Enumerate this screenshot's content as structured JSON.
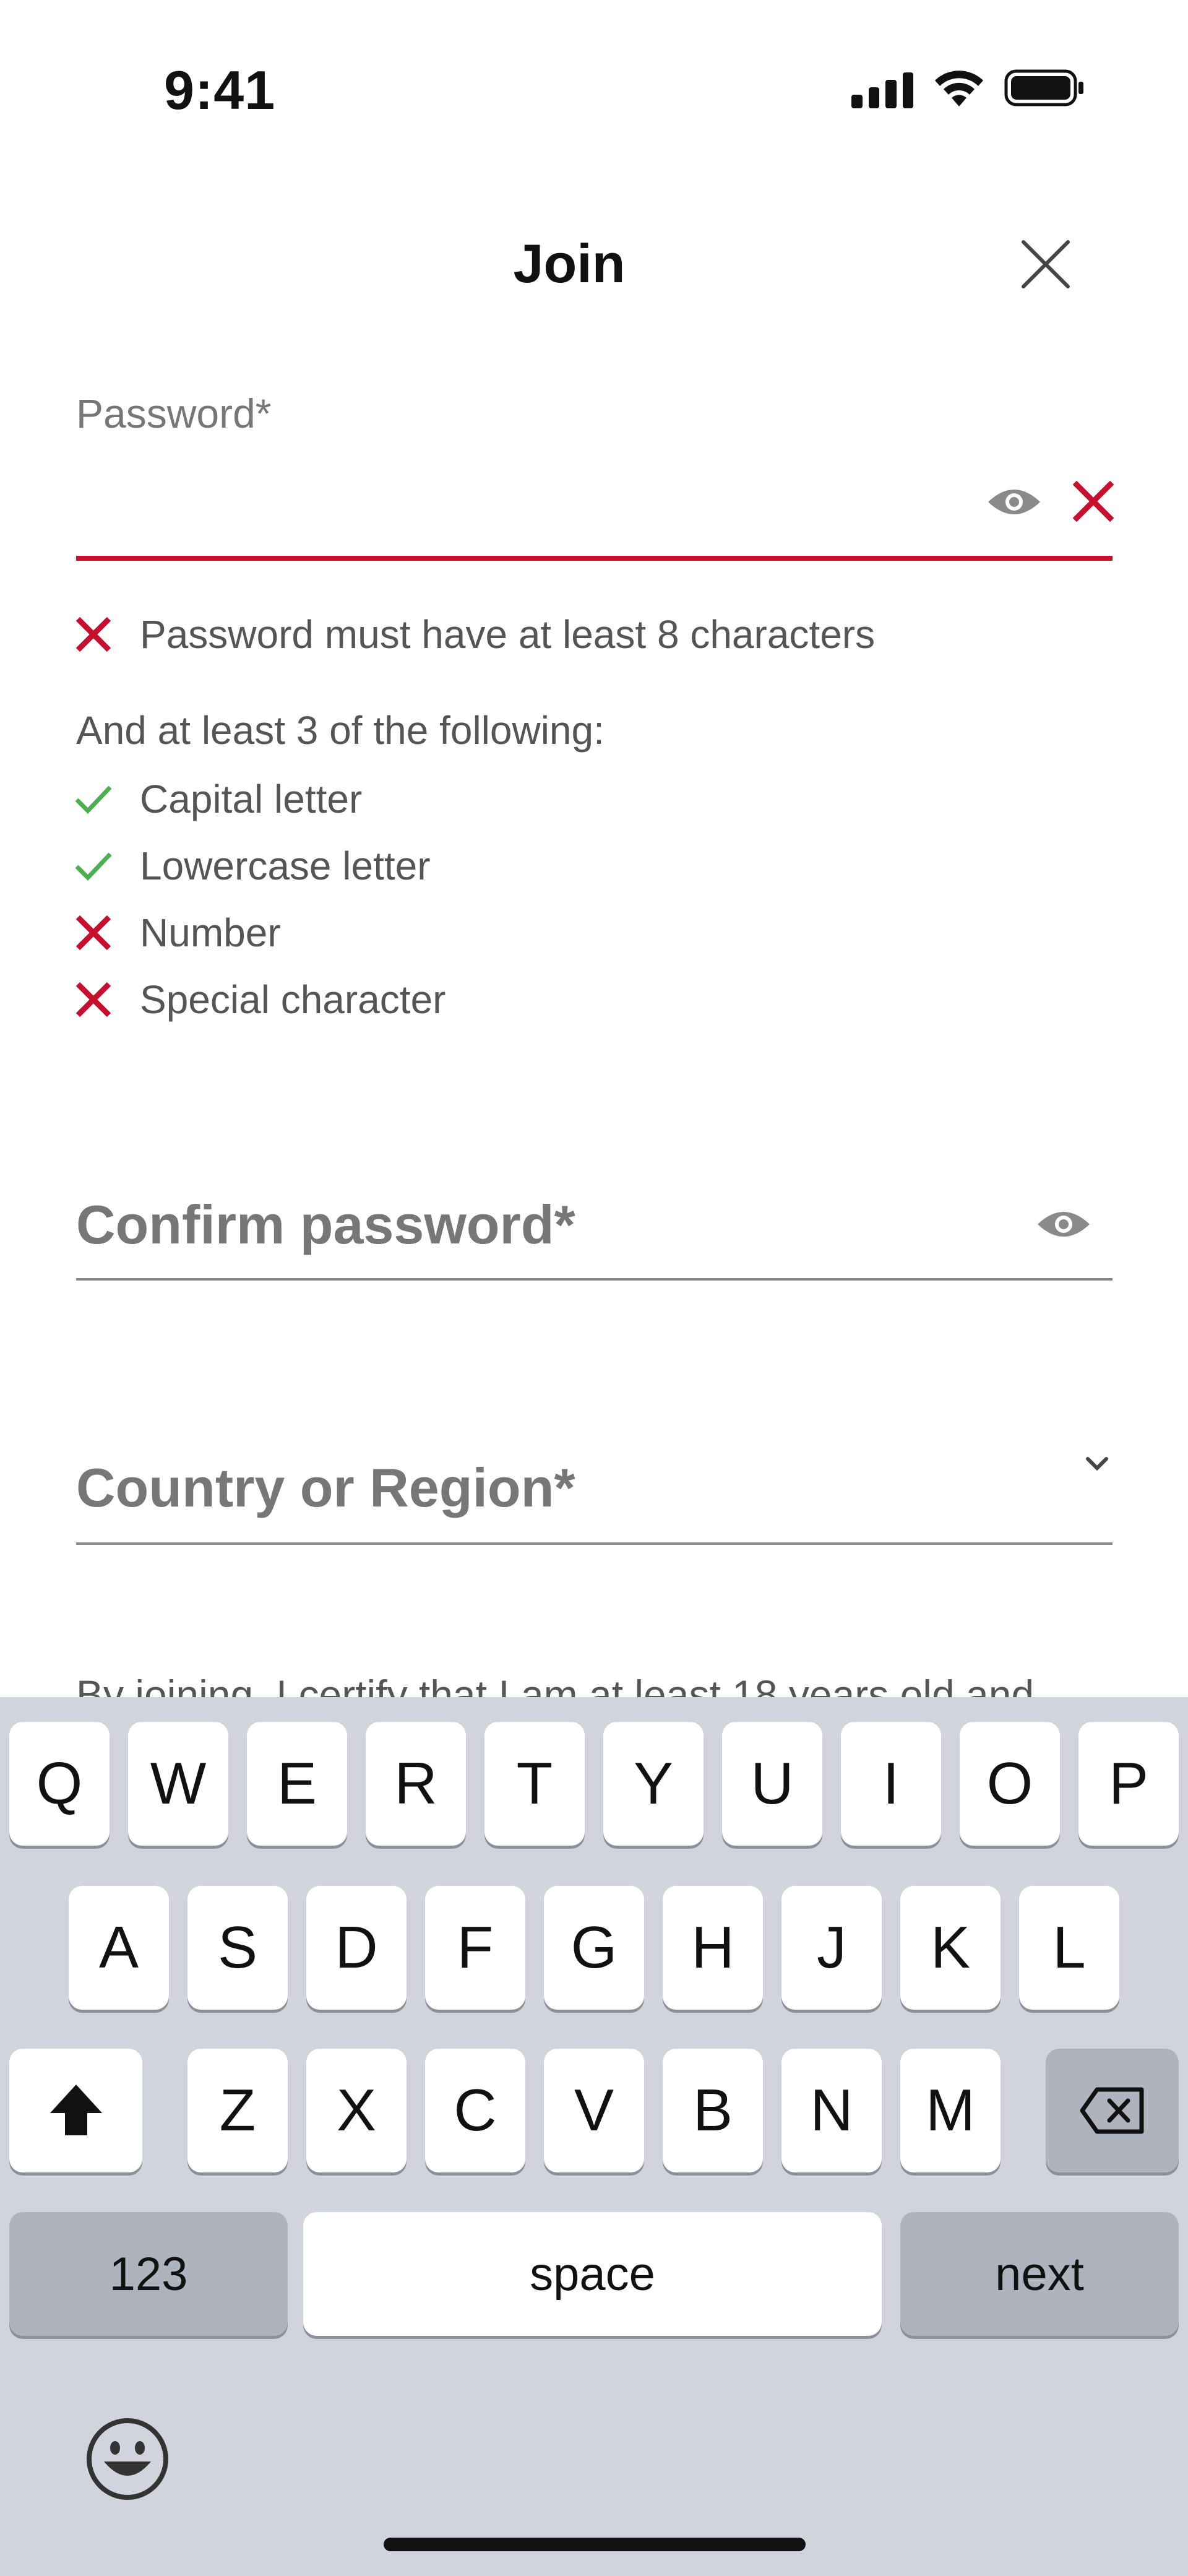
{
  "status_bar": {
    "time": "9:41"
  },
  "header": {
    "title": "Join"
  },
  "password": {
    "label": "Password*",
    "requirement_main": "Password must have at least 8 characters",
    "subheading": "And at least 3 of the following:",
    "rules": [
      {
        "label": "Capital letter",
        "state": "pass"
      },
      {
        "label": "Lowercase letter",
        "state": "pass"
      },
      {
        "label": "Number",
        "state": "fail"
      },
      {
        "label": "Special character",
        "state": "fail"
      }
    ]
  },
  "confirm_password": {
    "label": "Confirm password*"
  },
  "country": {
    "label": "Country or Region*"
  },
  "legal_text": "By joining, I certify that I am at least 18 years old and",
  "colors": {
    "error": "#c8102e",
    "success": "#4caf50",
    "muted": "#777777"
  },
  "keyboard": {
    "row1": [
      "Q",
      "W",
      "E",
      "R",
      "T",
      "Y",
      "U",
      "I",
      "O",
      "P"
    ],
    "row2": [
      "A",
      "S",
      "D",
      "F",
      "G",
      "H",
      "J",
      "K",
      "L"
    ],
    "row3": [
      "Z",
      "X",
      "C",
      "V",
      "B",
      "N",
      "M"
    ],
    "numbers_label": "123",
    "space_label": "space",
    "next_label": "next"
  }
}
